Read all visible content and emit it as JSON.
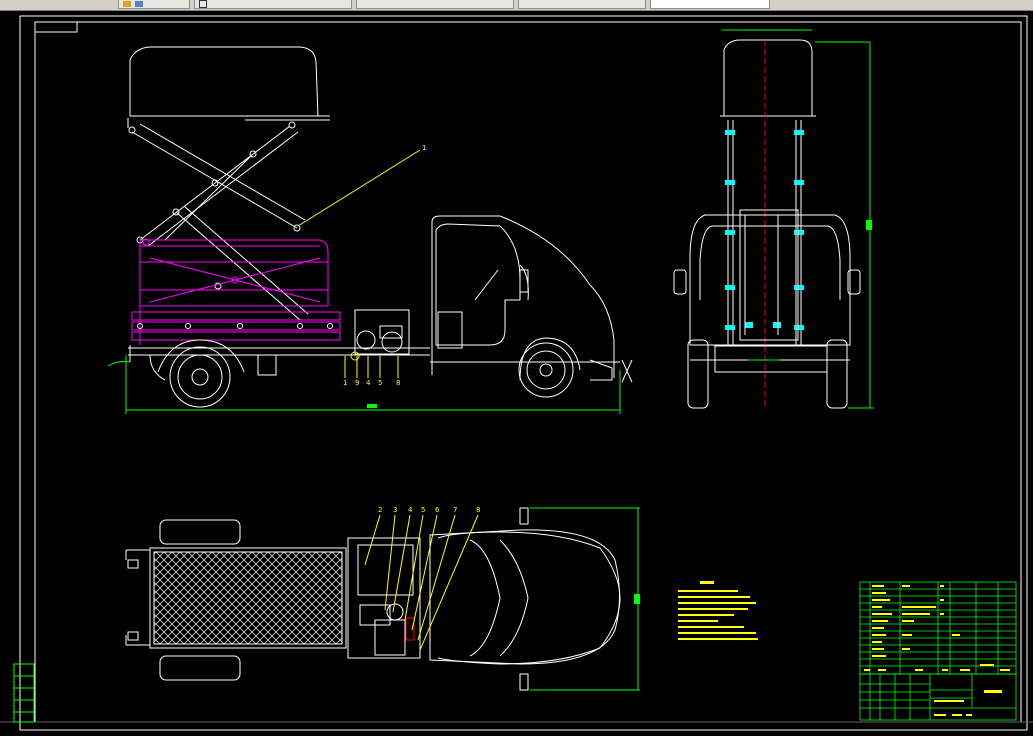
{
  "tabs": [
    {
      "label": "",
      "icon": "app-icons"
    },
    {
      "label": "",
      "icon": "document-icon"
    },
    {
      "label": ""
    },
    {
      "label": ""
    },
    {
      "label": ""
    }
  ],
  "drawing": {
    "views": [
      "side-view",
      "front-view",
      "top-view"
    ],
    "colors": {
      "frame": "#ffffff",
      "dimension": "#00ff00",
      "scissor_lowered": "#ff00ff",
      "leader": "#ffff00",
      "cylinder": "#00ffff",
      "centerline": "#ff0000"
    },
    "side_balloons": [
      "1",
      "9",
      "4",
      "5",
      "8"
    ],
    "top_balloons": [
      "2",
      "3",
      "4",
      "5",
      "6",
      "7",
      "8"
    ],
    "leader_balloon": "1",
    "notes_title": "",
    "notes_lines": [
      "",
      "",
      "",
      "",
      "",
      "",
      "",
      "",
      ""
    ]
  },
  "title_block": {
    "rows": 14,
    "drawing_name": ""
  }
}
